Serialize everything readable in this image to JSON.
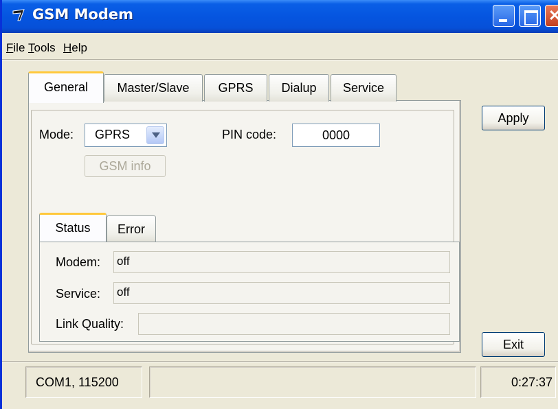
{
  "window": {
    "title": "GSM Modem",
    "title_icon": "gsm-logo-icon",
    "close_glyph": "✕"
  },
  "menu": {
    "file": "File",
    "tools": "Tools",
    "help": "Help"
  },
  "tabs": [
    {
      "label": "General"
    },
    {
      "label": "Master/Slave"
    },
    {
      "label": "GPRS"
    },
    {
      "label": "Dialup"
    },
    {
      "label": "Service"
    }
  ],
  "general": {
    "mode_label": "Mode:",
    "mode_value": "GPRS",
    "pin_label": "PIN code:",
    "pin_value": "0000",
    "gsm_info_button": "GSM info"
  },
  "status_tabs": [
    {
      "label": "Status"
    },
    {
      "label": "Error"
    }
  ],
  "status": {
    "modem_label": "Modem:",
    "modem_value": "off",
    "service_label": "Service:",
    "service_value": "off",
    "link_quality_label": "Link Quality:",
    "link_quality_value": ""
  },
  "buttons": {
    "apply": "Apply",
    "exit": "Exit"
  },
  "statusbar": {
    "port": "COM1, 115200",
    "middle": "",
    "time": "0:27:37"
  }
}
